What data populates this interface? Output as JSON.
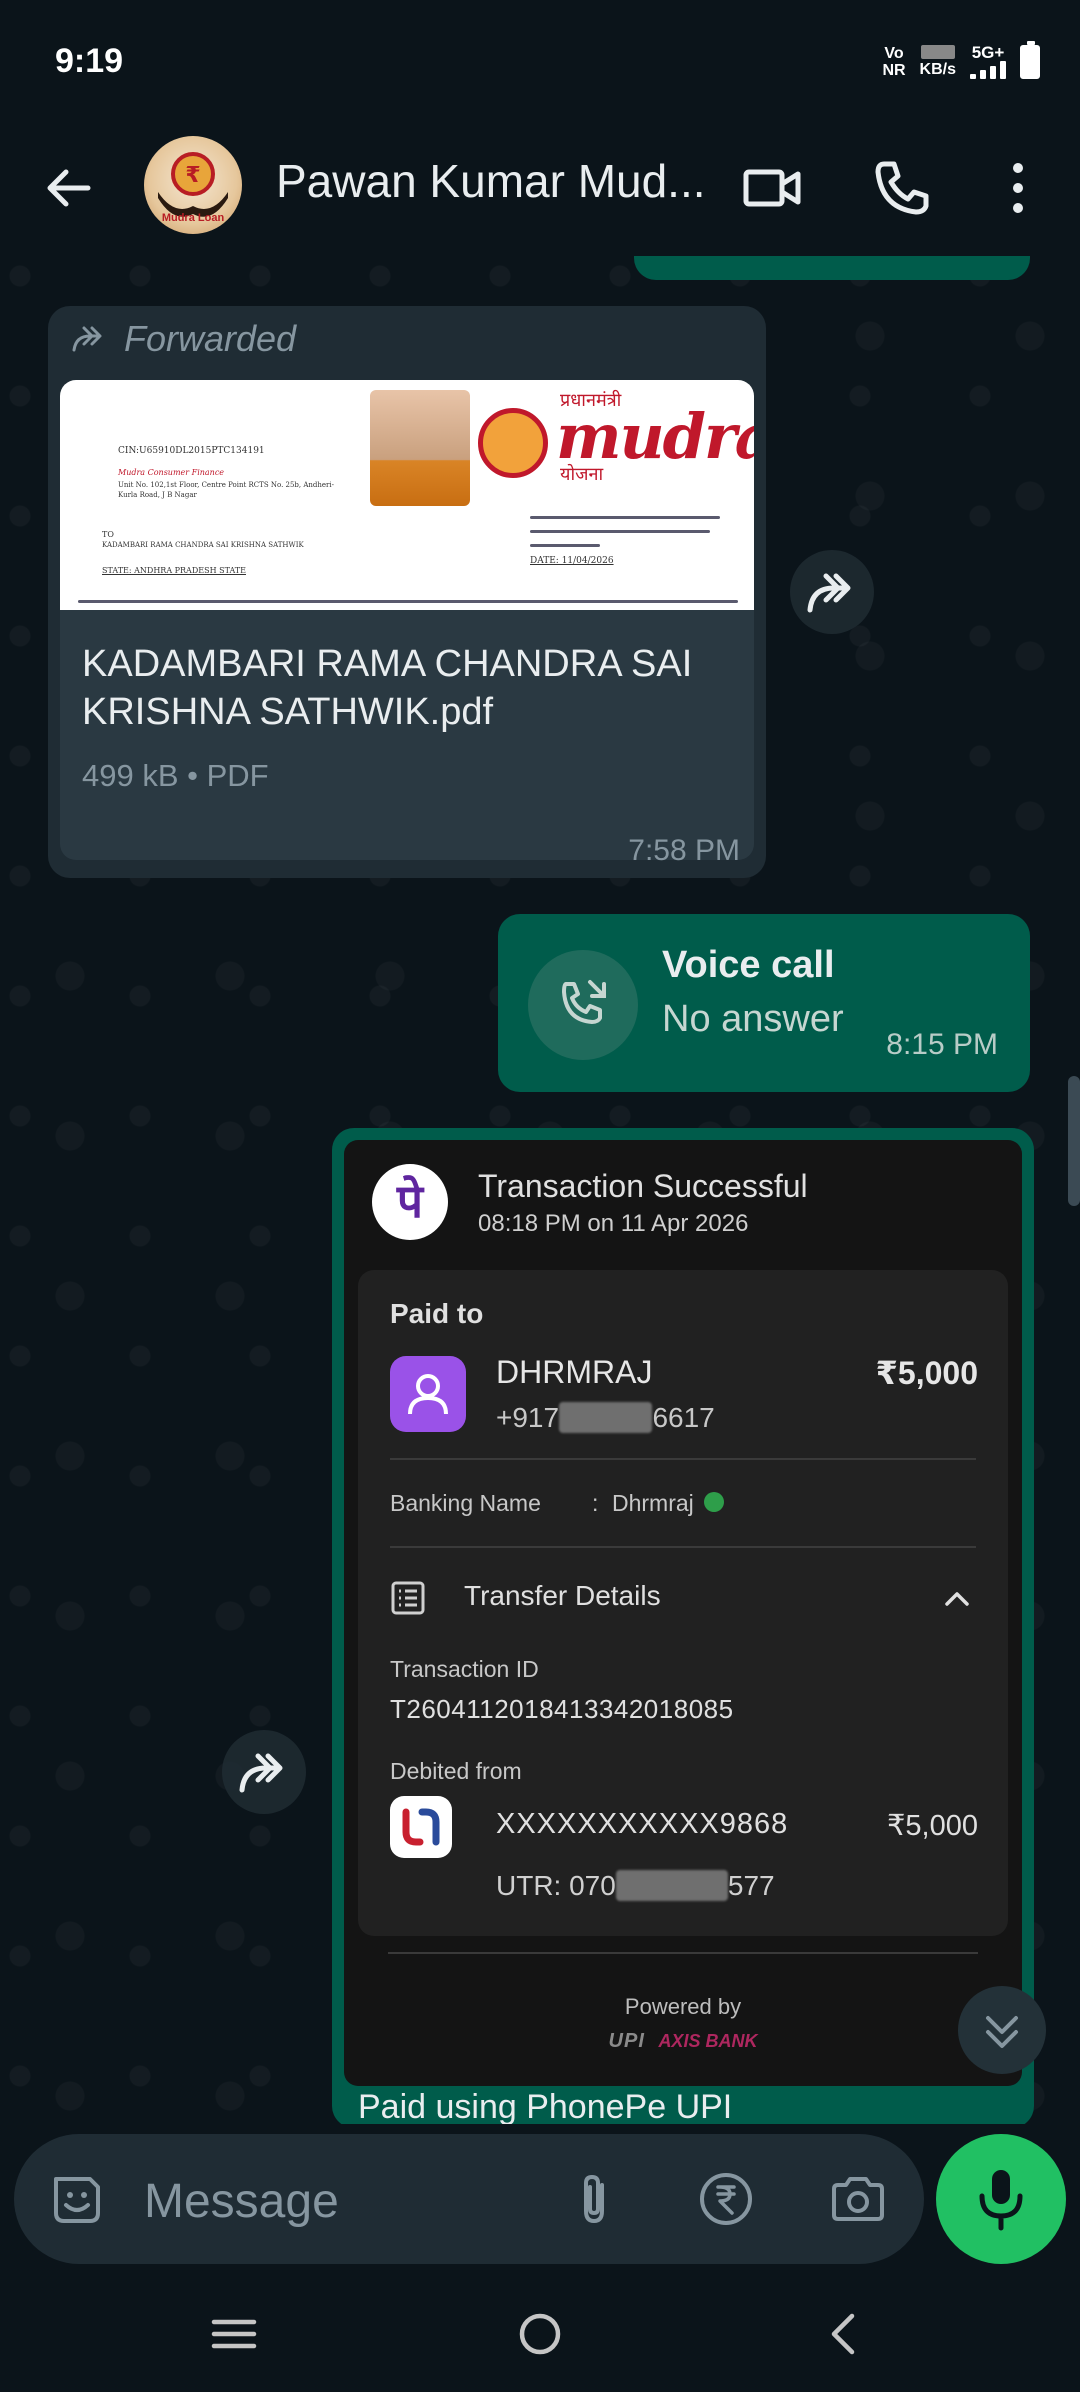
{
  "status_bar": {
    "time": "9:19",
    "net_label_top": "Vo",
    "net_label_bottom": "NR",
    "speed_unit": "KB/s",
    "network": "5G+"
  },
  "header": {
    "contact_name": "Pawan Kumar Mud...",
    "avatar_caption": "Mudra Loan"
  },
  "forwarded_doc": {
    "forwarded_label": "Forwarded",
    "preview_cin": "CIN:U65910DL2015PTC134191",
    "preview_company": "Mudra Consumer Finance",
    "preview_address": "Unit No. 102,1st Floor, Centre Point RCTS No. 25b, Andheri-Kurla Road, J B Nagar",
    "preview_to": "TO",
    "preview_recipient": "KADAMBARI RAMA CHANDRA SAI KRISHNA SATHWIK",
    "preview_state": "STATE: ANDHRA PRADESH STATE",
    "preview_date": "DATE: 11/04/2026",
    "preview_brand": "mudra",
    "preview_hindi": "प्रधानमंत्री",
    "preview_yojana": "योजना",
    "file_name": "KADAMBARI RAMA CHANDRA SAI KRISHNA SATHWIK.pdf",
    "file_meta": "499 kB • PDF",
    "time": "7:58 PM"
  },
  "voice_call": {
    "title": "Voice call",
    "status": "No answer",
    "time": "8:15 PM"
  },
  "transaction": {
    "app_logo": "पे",
    "title": "Transaction Successful",
    "datetime": "08:18 PM on 11 Apr 2026",
    "paid_to_label": "Paid to",
    "payee_name": "DHRMRAJ",
    "payee_phone_prefix": "+917",
    "payee_phone_suffix": "6617",
    "amount": "₹5,000",
    "banking_name_label": "Banking Name",
    "banking_name_colon": ":",
    "banking_name_value": "Dhrmraj",
    "transfer_details_label": "Transfer Details",
    "transaction_id_label": "Transaction ID",
    "transaction_id": "T2604112018413342018085",
    "debited_from_label": "Debited from",
    "account": "XXXXXXXXXXX9868",
    "debit_amount": "₹5,000",
    "utr_prefix": "UTR: 070",
    "utr_suffix": "577",
    "powered_by": "Powered by",
    "logo_upi": "UPI",
    "logo_axis": "AXIS BANK",
    "caption": "Paid using PhonePe UPI"
  },
  "composer": {
    "placeholder": "Message"
  },
  "colors": {
    "background": "#0b141a",
    "incoming_bubble": "#1f2c34",
    "outgoing_bubble": "#005c4b",
    "mic_button": "#21c063",
    "phonepe_purple": "#5f259f"
  }
}
